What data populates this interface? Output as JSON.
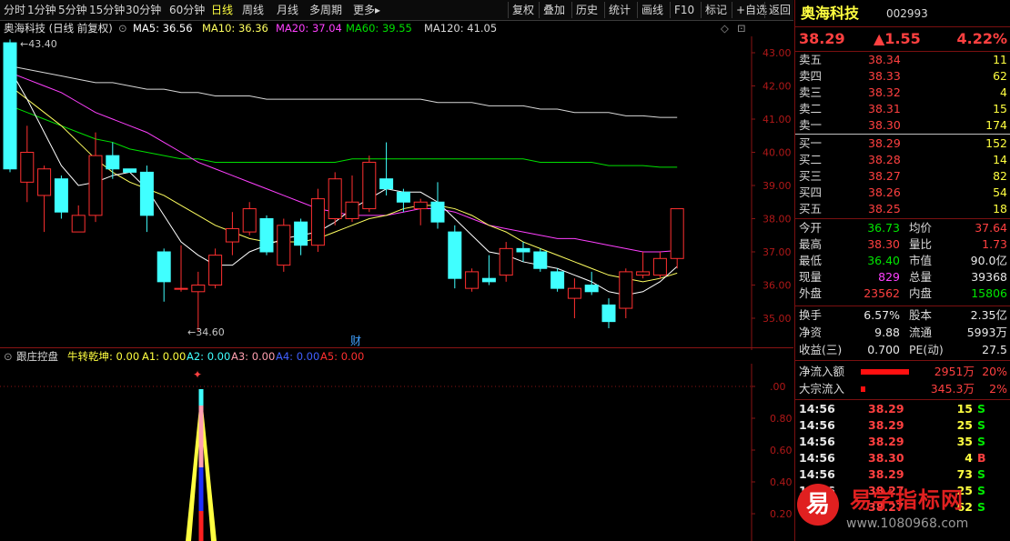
{
  "toolbar": {
    "periods": [
      "分时",
      "1分钟",
      "5分钟",
      "15分钟",
      "30分钟",
      "60分钟",
      "日线",
      "周线",
      "月线",
      "多周期",
      "更多▸"
    ],
    "active": "日线",
    "actions": [
      "复权",
      "叠加",
      "历史",
      "统计",
      "画线",
      "F10",
      "标记",
      "+自选",
      "返回"
    ]
  },
  "chart": {
    "title": "奥海科技 (日线 前复权)",
    "ma5": "MA5: 36.56",
    "ma10": "MA10: 36.36",
    "ma20": "MA20: 37.04",
    "ma60": "MA60: 39.55",
    "ma120": "MA120: 41.05",
    "high_label": "43.40",
    "low_label": "34.60",
    "event_mark": "财",
    "y_ticks": [
      "43.00",
      "42.00",
      "41.00",
      "40.00",
      "39.00",
      "38.00",
      "37.00",
      "36.00",
      "35.00"
    ]
  },
  "indicator": {
    "name": "跟庄控盘",
    "nzqk": "牛转乾坤: 0.00",
    "a1": "A1: 0.00",
    "a2": "A2: 0.00",
    "a3": "A3: 0.00",
    "a4": "A4: 0.00",
    "a5": "A5: 0.00",
    "y_ticks": [
      ".00",
      "0.80",
      "0.60",
      "0.40",
      "0.20"
    ]
  },
  "colors": {
    "up": "#ff3030",
    "down": "#40ffff",
    "ma5": "#ffffff",
    "ma10": "#ffff60",
    "ma20": "#ff40ff",
    "ma60": "#00e000",
    "ma120": "#d8d8d8"
  },
  "chart_data": {
    "type": "candlestick",
    "ylim": [
      34.6,
      43.4
    ],
    "candles": [
      {
        "o": 43.3,
        "c": 39.5,
        "h": 43.4,
        "l": 39.4
      },
      {
        "o": 39.1,
        "c": 40.0,
        "h": 40.8,
        "l": 38.5
      },
      {
        "o": 38.7,
        "c": 39.5,
        "h": 39.6,
        "l": 37.6
      },
      {
        "o": 39.2,
        "c": 38.2,
        "h": 39.3,
        "l": 38.0
      },
      {
        "o": 37.6,
        "c": 38.1,
        "h": 38.4,
        "l": 37.6
      },
      {
        "o": 38.1,
        "c": 39.9,
        "h": 40.6,
        "l": 37.9
      },
      {
        "o": 39.9,
        "c": 39.5,
        "h": 40.3,
        "l": 39.2
      },
      {
        "o": 39.5,
        "c": 39.4,
        "h": 39.5,
        "l": 39.4
      },
      {
        "o": 39.4,
        "c": 38.1,
        "h": 39.6,
        "l": 37.6
      },
      {
        "o": 37.0,
        "c": 36.1,
        "h": 37.1,
        "l": 35.5
      },
      {
        "o": 35.9,
        "c": 35.9,
        "h": 37.2,
        "l": 35.8
      },
      {
        "o": 35.8,
        "c": 36.0,
        "h": 36.4,
        "l": 34.6
      },
      {
        "o": 36.0,
        "c": 36.9,
        "h": 37.1,
        "l": 35.9
      },
      {
        "o": 37.3,
        "c": 37.7,
        "h": 38.2,
        "l": 36.9
      },
      {
        "o": 37.6,
        "c": 38.3,
        "h": 38.5,
        "l": 37.5
      },
      {
        "o": 38.0,
        "c": 37.0,
        "h": 38.1,
        "l": 36.9
      },
      {
        "o": 36.6,
        "c": 37.8,
        "h": 38.0,
        "l": 36.4
      },
      {
        "o": 37.9,
        "c": 37.2,
        "h": 38.0,
        "l": 36.9
      },
      {
        "o": 37.2,
        "c": 38.6,
        "h": 38.9,
        "l": 37.0
      },
      {
        "o": 38.0,
        "c": 39.2,
        "h": 39.4,
        "l": 37.8
      },
      {
        "o": 38.0,
        "c": 38.5,
        "h": 39.3,
        "l": 37.9
      },
      {
        "o": 38.3,
        "c": 39.7,
        "h": 39.9,
        "l": 38.2
      },
      {
        "o": 39.2,
        "c": 38.9,
        "h": 40.3,
        "l": 38.7
      },
      {
        "o": 38.8,
        "c": 38.5,
        "h": 38.9,
        "l": 38.2
      },
      {
        "o": 38.3,
        "c": 38.5,
        "h": 38.6,
        "l": 37.8
      },
      {
        "o": 38.5,
        "c": 37.9,
        "h": 39.1,
        "l": 37.7
      },
      {
        "o": 37.6,
        "c": 36.2,
        "h": 37.8,
        "l": 35.9
      },
      {
        "o": 35.9,
        "c": 36.4,
        "h": 36.5,
        "l": 35.8
      },
      {
        "o": 36.2,
        "c": 36.1,
        "h": 36.9,
        "l": 36.0
      },
      {
        "o": 36.3,
        "c": 37.1,
        "h": 37.3,
        "l": 36.1
      },
      {
        "o": 37.1,
        "c": 37.0,
        "h": 37.3,
        "l": 36.7
      },
      {
        "o": 37.0,
        "c": 36.5,
        "h": 37.1,
        "l": 36.4
      },
      {
        "o": 36.4,
        "c": 35.9,
        "h": 36.5,
        "l": 35.8
      },
      {
        "o": 35.6,
        "c": 35.9,
        "h": 36.2,
        "l": 35.0
      },
      {
        "o": 36.0,
        "c": 35.8,
        "h": 36.4,
        "l": 35.7
      },
      {
        "o": 35.4,
        "c": 34.9,
        "h": 35.6,
        "l": 34.7
      },
      {
        "o": 35.3,
        "c": 36.4,
        "h": 36.5,
        "l": 35.0
      },
      {
        "o": 36.3,
        "c": 36.4,
        "h": 37.0,
        "l": 36.2
      },
      {
        "o": 36.3,
        "c": 36.8,
        "h": 37.0,
        "l": 36.2
      },
      {
        "o": 36.8,
        "c": 38.3,
        "h": 38.3,
        "l": 36.5
      }
    ],
    "ma5": [
      42.5,
      41.6,
      40.6,
      39.6,
      39.0,
      39.1,
      39.3,
      39.4,
      38.9,
      38.1,
      37.3,
      36.9,
      36.6,
      36.6,
      37.0,
      37.2,
      37.4,
      37.5,
      37.6,
      37.9,
      38.3,
      38.6,
      38.9,
      38.8,
      38.8,
      38.5,
      38.0,
      37.5,
      37.0,
      36.9,
      36.7,
      36.6,
      36.5,
      36.3,
      36.1,
      35.8,
      35.7,
      35.8,
      36.1,
      36.56
    ],
    "ma10": [
      42.0,
      41.6,
      41.2,
      40.8,
      40.3,
      39.8,
      39.4,
      39.1,
      38.9,
      38.7,
      38.4,
      38.1,
      37.8,
      37.6,
      37.4,
      37.3,
      37.3,
      37.3,
      37.4,
      37.6,
      37.8,
      38.0,
      38.1,
      38.3,
      38.4,
      38.4,
      38.3,
      38.1,
      37.8,
      37.6,
      37.3,
      37.1,
      36.9,
      36.7,
      36.5,
      36.3,
      36.2,
      36.1,
      36.2,
      36.36
    ],
    "ma20": [
      42.4,
      42.2,
      42.0,
      41.8,
      41.5,
      41.2,
      41.0,
      40.8,
      40.6,
      40.3,
      40.0,
      39.7,
      39.5,
      39.3,
      39.1,
      38.9,
      38.7,
      38.5,
      38.3,
      38.2,
      38.1,
      38.1,
      38.1,
      38.2,
      38.3,
      38.3,
      38.2,
      38.0,
      37.8,
      37.7,
      37.6,
      37.5,
      37.4,
      37.4,
      37.3,
      37.2,
      37.1,
      37.0,
      37.0,
      37.04
    ],
    "ma60": [
      41.4,
      41.2,
      41.0,
      40.8,
      40.6,
      40.4,
      40.3,
      40.1,
      40.0,
      39.9,
      39.8,
      39.8,
      39.7,
      39.7,
      39.7,
      39.7,
      39.7,
      39.7,
      39.7,
      39.7,
      39.8,
      39.8,
      39.8,
      39.8,
      39.8,
      39.8,
      39.8,
      39.8,
      39.8,
      39.8,
      39.8,
      39.7,
      39.7,
      39.7,
      39.7,
      39.6,
      39.6,
      39.6,
      39.55,
      39.55
    ],
    "ma120": [
      42.6,
      42.5,
      42.4,
      42.3,
      42.2,
      42.1,
      42.1,
      42.0,
      41.9,
      41.9,
      41.8,
      41.8,
      41.7,
      41.7,
      41.7,
      41.6,
      41.6,
      41.6,
      41.6,
      41.6,
      41.6,
      41.6,
      41.6,
      41.6,
      41.6,
      41.5,
      41.5,
      41.5,
      41.4,
      41.4,
      41.4,
      41.3,
      41.3,
      41.2,
      41.2,
      41.2,
      41.1,
      41.1,
      41.05,
      41.05
    ]
  },
  "panel": {
    "name": "奥海科技",
    "code": "002993",
    "price": "38.29",
    "change": "▲1.55",
    "change_pct": "4.22%",
    "asks": [
      {
        "label": "卖五",
        "price": "38.34",
        "vol": "11"
      },
      {
        "label": "卖四",
        "price": "38.33",
        "vol": "62"
      },
      {
        "label": "卖三",
        "price": "38.32",
        "vol": "4"
      },
      {
        "label": "卖二",
        "price": "38.31",
        "vol": "15"
      },
      {
        "label": "卖一",
        "price": "38.30",
        "vol": "174"
      }
    ],
    "bids": [
      {
        "label": "买一",
        "price": "38.29",
        "vol": "152"
      },
      {
        "label": "买二",
        "price": "38.28",
        "vol": "14"
      },
      {
        "label": "买三",
        "price": "38.27",
        "vol": "82"
      },
      {
        "label": "买四",
        "price": "38.26",
        "vol": "54"
      },
      {
        "label": "买五",
        "price": "38.25",
        "vol": "18"
      }
    ],
    "stats": [
      {
        "l1": "今开",
        "v1": "36.73",
        "c1": "green",
        "l2": "均价",
        "v2": "37.64",
        "c2": "red"
      },
      {
        "l1": "最高",
        "v1": "38.30",
        "c1": "red",
        "l2": "量比",
        "v2": "1.73",
        "c2": "red"
      },
      {
        "l1": "最低",
        "v1": "36.40",
        "c1": "green",
        "l2": "市值",
        "v2": "90.0亿",
        "c2": "white"
      },
      {
        "l1": "现量",
        "v1": "829",
        "c1": "magenta",
        "l2": "总量",
        "v2": "39368",
        "c2": "white"
      },
      {
        "l1": "外盘",
        "v1": "23562",
        "c1": "red",
        "l2": "内盘",
        "v2": "15806",
        "c2": "green"
      }
    ],
    "stats2": [
      {
        "l1": "换手",
        "v1": "6.57%",
        "l2": "股本",
        "v2": "2.35亿"
      },
      {
        "l1": "净资",
        "v1": "9.88",
        "l2": "流通",
        "v2": "5993万"
      },
      {
        "l1": "收益(三)",
        "v1": "0.700",
        "l2": "PE(动)",
        "v2": "27.5"
      }
    ],
    "flows": [
      {
        "label": "净流入额",
        "value": "2951万",
        "pct": "20%",
        "bar": 0.8
      },
      {
        "label": "大宗流入",
        "value": "345.3万",
        "pct": "2%",
        "bar": 0.08
      }
    ],
    "ticks": [
      {
        "time": "14:56",
        "price": "38.29",
        "vol": "15",
        "side": "S"
      },
      {
        "time": "14:56",
        "price": "38.29",
        "vol": "25",
        "side": "S"
      },
      {
        "time": "14:56",
        "price": "38.29",
        "vol": "35",
        "side": "S"
      },
      {
        "time": "14:56",
        "price": "38.30",
        "vol": "4",
        "side": "B"
      },
      {
        "time": "14:56",
        "price": "38.29",
        "vol": "73",
        "side": "S"
      },
      {
        "time": "14:56",
        "price": "38.27",
        "vol": "25",
        "side": "S"
      },
      {
        "time": "14:56",
        "price": "38.27",
        "vol": "62",
        "side": "S"
      }
    ]
  },
  "watermark": {
    "badge": "易",
    "title": "易学指标网",
    "url": "www.1080968.com"
  }
}
